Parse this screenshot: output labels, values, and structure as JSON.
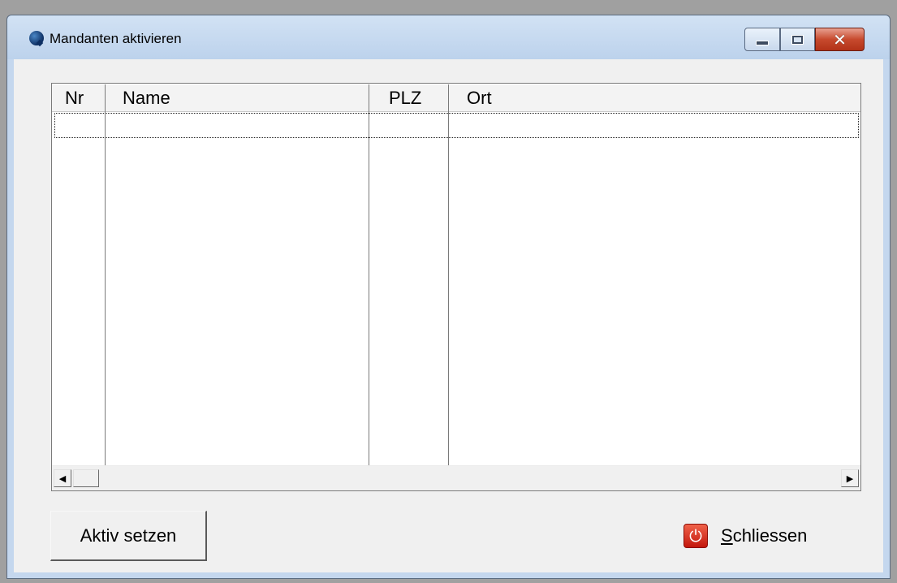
{
  "window": {
    "title": "Mandanten aktivieren"
  },
  "titlebar": {
    "minimize_glyph": "",
    "maximize_glyph": "",
    "close_glyph": "✕"
  },
  "table": {
    "columns": [
      "Nr",
      "Name",
      "PLZ",
      "Ort"
    ],
    "rows": []
  },
  "scrollbar": {
    "left_arrow": "◀",
    "right_arrow": "▶"
  },
  "buttons": {
    "activate_label": "Aktiv setzen",
    "close_accel": "S",
    "close_rest": "chliessen"
  },
  "icons": {
    "power_glyph": "⏻"
  },
  "colors": {
    "title_bar": "#c4d7ee",
    "close_button": "#c74a2e",
    "power_icon": "#d9261a"
  }
}
